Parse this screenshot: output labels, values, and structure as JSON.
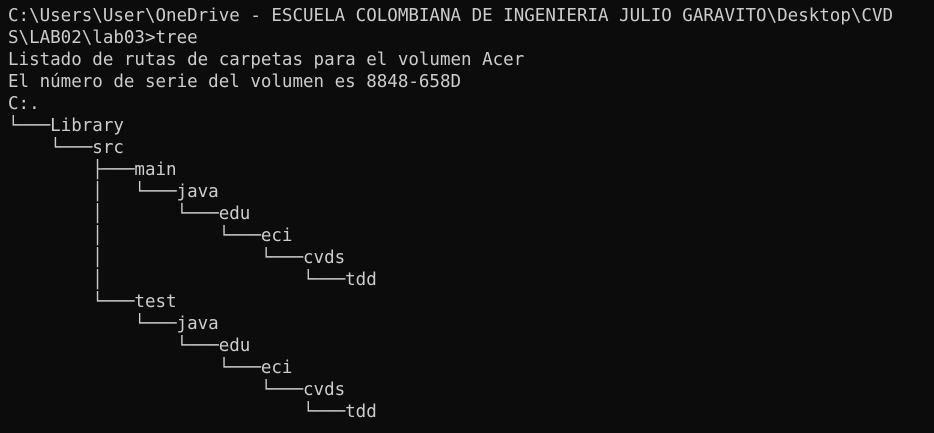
{
  "terminal": {
    "lines": [
      "C:\\Users\\User\\OneDrive - ESCUELA COLOMBIANA DE INGENIERIA JULIO GARAVITO\\Desktop\\CVD",
      "S\\LAB02\\lab03>tree",
      "Listado de rutas de carpetas para el volumen Acer",
      "El número de serie del volumen es 8848-658D",
      "C:.",
      "└───Library",
      "    └───src",
      "        ├───main",
      "        │   └───java",
      "        │       └───edu",
      "        │           └───eci",
      "        │               └───cvds",
      "        │                   └───tdd",
      "        └───test",
      "            └───java",
      "                └───edu",
      "                    └───eci",
      "                        └───cvds",
      "                            └───tdd"
    ]
  },
  "colors": {
    "background": "#0c0c0c",
    "text": "#cccccc"
  }
}
